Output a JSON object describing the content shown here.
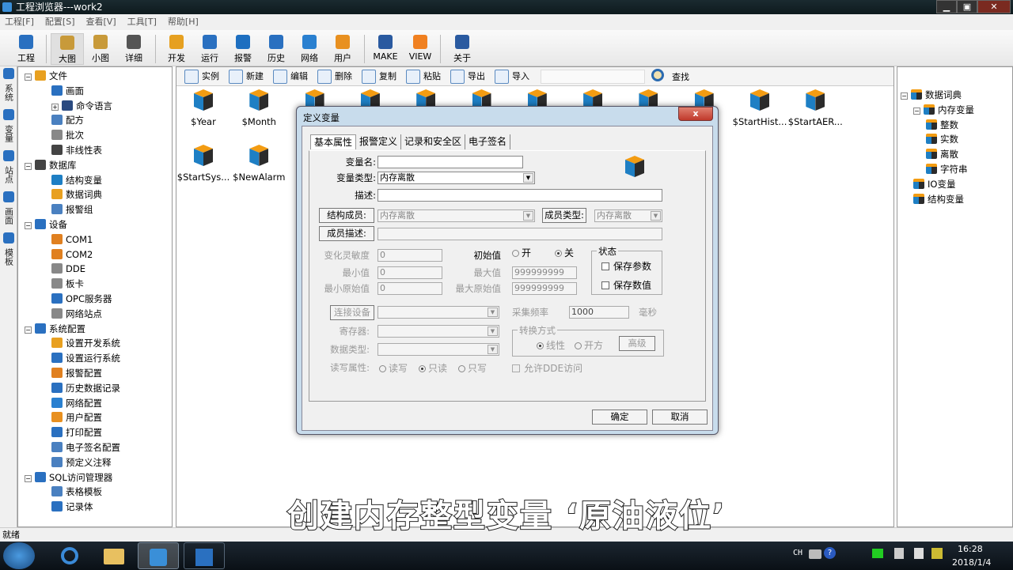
{
  "window": {
    "title": "工程浏览器---work2",
    "min": "▁",
    "max": "▣",
    "close": "✕"
  },
  "menu": [
    "工程[F]",
    "配置[S]",
    "查看[V]",
    "工具[T]",
    "帮助[H]"
  ],
  "toolbar": [
    {
      "label": "工程",
      "color": "#2a70c0"
    },
    {
      "label": "大图",
      "color": "#c89a3a"
    },
    {
      "label": "小图",
      "color": "#c89a3a"
    },
    {
      "label": "详细",
      "color": "#555"
    },
    {
      "label": "开发",
      "color": "#e6a020"
    },
    {
      "label": "运行",
      "color": "#2a70c0"
    },
    {
      "label": "报警",
      "color": "#1e6fc0"
    },
    {
      "label": "历史",
      "color": "#2a70c0"
    },
    {
      "label": "网络",
      "color": "#2a80d0"
    },
    {
      "label": "用户",
      "color": "#e89020"
    },
    {
      "label": "MAKE",
      "color": "#2a5aa0"
    },
    {
      "label": "VIEW",
      "color": "#f08020"
    },
    {
      "label": "关于",
      "color": "#2a5aa0"
    }
  ],
  "vtabs": [
    "系统",
    "变量",
    "站点",
    "画面",
    "模板"
  ],
  "left_tree": [
    {
      "label": "文件",
      "level": 0,
      "exp": "−",
      "color": "#e8a020"
    },
    {
      "label": "画面",
      "level": 1,
      "color": "#2a70c0"
    },
    {
      "label": "命令语言",
      "level": 1,
      "exp": "+",
      "color": "#2a4a80"
    },
    {
      "label": "配方",
      "level": 1,
      "color": "#4a80c0"
    },
    {
      "label": "批次",
      "level": 1,
      "color": "#888"
    },
    {
      "label": "非线性表",
      "level": 1,
      "color": "#444"
    },
    {
      "label": "数据库",
      "level": 0,
      "exp": "−",
      "color": "#444"
    },
    {
      "label": "结构变量",
      "level": 1,
      "color": "#1e7fc4"
    },
    {
      "label": "数据词典",
      "level": 1,
      "color": "#e8a020"
    },
    {
      "label": "报警组",
      "level": 1,
      "color": "#4a80c0"
    },
    {
      "label": "设备",
      "level": 0,
      "exp": "−",
      "color": "#2a70c0"
    },
    {
      "label": "COM1",
      "level": 1,
      "color": "#e08020"
    },
    {
      "label": "COM2",
      "level": 1,
      "color": "#e08020"
    },
    {
      "label": "DDE",
      "level": 1,
      "color": "#888"
    },
    {
      "label": "板卡",
      "level": 1,
      "color": "#888"
    },
    {
      "label": "OPC服务器",
      "level": 1,
      "color": "#2a70c0"
    },
    {
      "label": "网络站点",
      "level": 1,
      "color": "#888"
    },
    {
      "label": "系统配置",
      "level": 0,
      "exp": "−",
      "color": "#2a70c0"
    },
    {
      "label": "设置开发系统",
      "level": 1,
      "color": "#e8a020"
    },
    {
      "label": "设置运行系统",
      "level": 1,
      "color": "#2a70c0"
    },
    {
      "label": "报警配置",
      "level": 1,
      "color": "#e08020"
    },
    {
      "label": "历史数据记录",
      "level": 1,
      "color": "#2a70c0"
    },
    {
      "label": "网络配置",
      "level": 1,
      "color": "#2a80d0"
    },
    {
      "label": "用户配置",
      "level": 1,
      "color": "#e89020"
    },
    {
      "label": "打印配置",
      "level": 1,
      "color": "#2a70c0"
    },
    {
      "label": "电子签名配置",
      "level": 1,
      "color": "#4a80c0"
    },
    {
      "label": "预定义注释",
      "level": 1,
      "color": "#4a80c0"
    },
    {
      "label": "SQL访问管理器",
      "level": 0,
      "exp": "−",
      "color": "#2a70c0"
    },
    {
      "label": "表格模板",
      "level": 1,
      "color": "#4a80c0"
    },
    {
      "label": "记录体",
      "level": 1,
      "color": "#2a70c0"
    }
  ],
  "subtoolbar": [
    "实例",
    "新建",
    "编辑",
    "删除",
    "复制",
    "粘贴",
    "导出",
    "导入"
  ],
  "search": {
    "placeholder": "",
    "label": "查找"
  },
  "variables_row1": [
    "$Year",
    "$Month",
    "",
    "",
    "",
    "",
    "",
    "",
    "",
    "",
    "$StartHist...",
    "$StartAER..."
  ],
  "variables_row2": [
    "$StartSys...",
    "$NewAlarm"
  ],
  "right_tree": [
    {
      "label": "数据词典",
      "level": 0,
      "exp": "−"
    },
    {
      "label": "内存变量",
      "level": 1,
      "exp": "−"
    },
    {
      "label": "整数",
      "level": 2
    },
    {
      "label": "实数",
      "level": 2
    },
    {
      "label": "离散",
      "level": 2
    },
    {
      "label": "字符串",
      "level": 2
    },
    {
      "label": "IO变量",
      "level": 1
    },
    {
      "label": "结构变量",
      "level": 1
    }
  ],
  "status": "就绪",
  "dialog": {
    "title": "定义变量",
    "close": "x",
    "tabs": [
      "基本属性",
      "报警定义",
      "记录和安全区",
      "电子签名"
    ],
    "var_name_label": "变量名:",
    "var_name": "",
    "var_type_label": "变量类型:",
    "var_type": "内存离散",
    "desc_label": "描述:",
    "desc": "",
    "struct_member_label": "结构成员:",
    "struct_member": "内存离散",
    "member_type_label": "成员类型:",
    "member_type": "内存离散",
    "member_desc_label": "成员描述:",
    "sensitivity_label": "变化灵敏度",
    "sensitivity": "0",
    "min_label": "最小值",
    "min": "0",
    "min_raw_label": "最小原始值",
    "min_raw": "0",
    "init_label": "初始值",
    "on": "开",
    "off": "关",
    "init_value": "关",
    "max_label": "最大值",
    "max": "999999999",
    "max_raw_label": "最大原始值",
    "max_raw": "999999999",
    "state_label": "状态",
    "save_param": "保存参数",
    "save_value": "保存数值",
    "connect_device": "连接设备",
    "register_label": "寄存器:",
    "datatype_label": "数据类型:",
    "rw_label": "读写属性:",
    "rw_options": [
      "读写",
      "只读",
      "只写"
    ],
    "rw_value": "只读",
    "freq_label": "采集频率",
    "freq": "1000",
    "freq_unit": "毫秒",
    "convert_label": "转换方式",
    "linear": "线性",
    "sqrt": "开方",
    "advanced": "高级",
    "allow_dde": "允许DDE访问",
    "ok": "确定",
    "cancel": "取消"
  },
  "caption": "创建内存整型变量 ‘原油液位’",
  "tray": {
    "lang": "CH",
    "time": "16:28",
    "date": "2018/1/4"
  }
}
